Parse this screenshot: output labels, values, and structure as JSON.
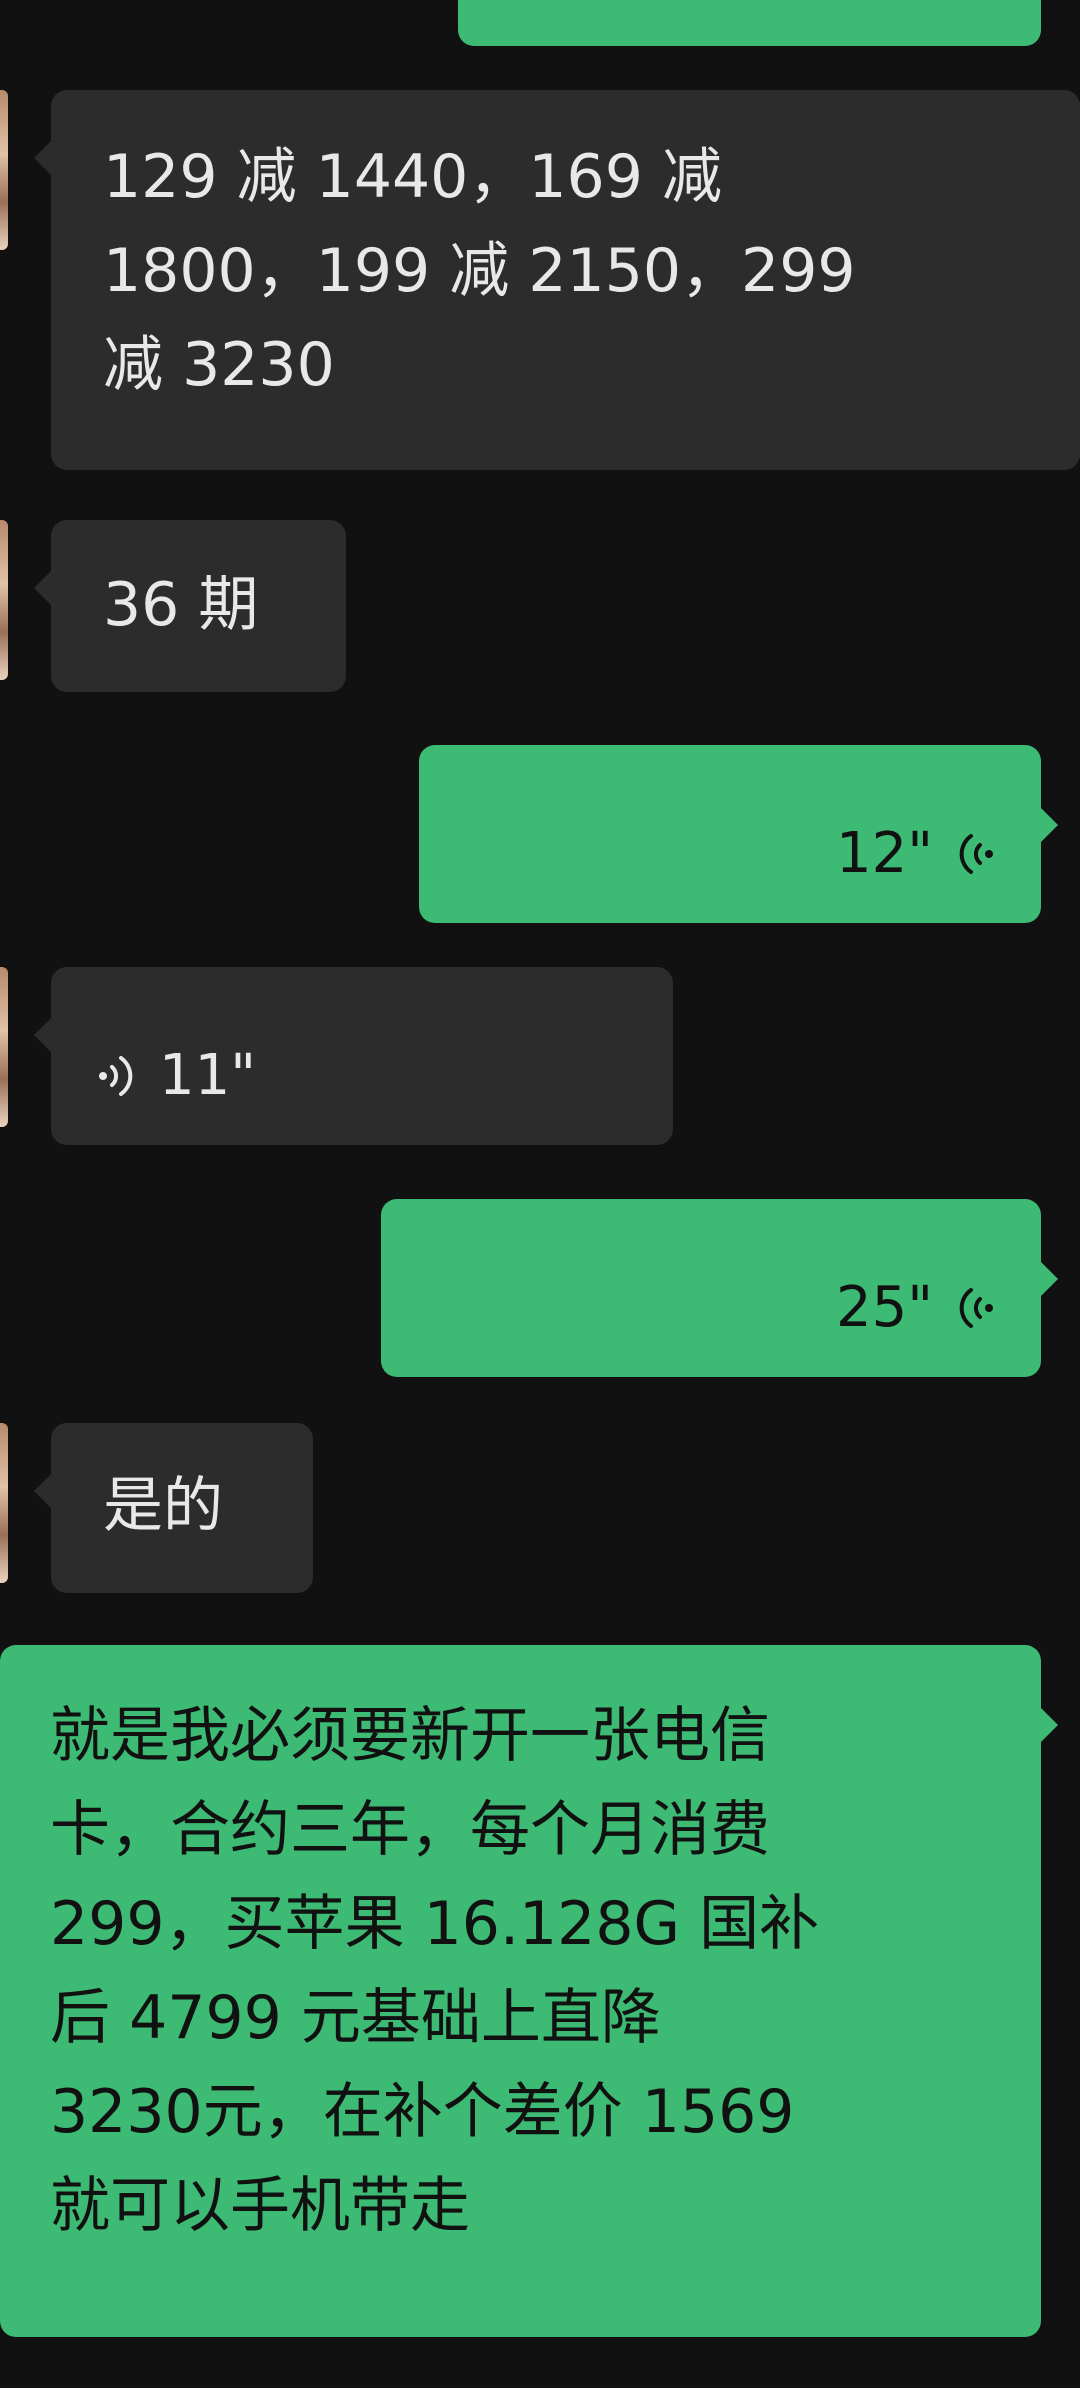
{
  "messages": [
    {
      "direction": "outgoing",
      "type": "text",
      "text": ""
    },
    {
      "direction": "incoming",
      "type": "text",
      "text": "129 减 1440，169 减\n1800，199 减 2150，299\n减 3230"
    },
    {
      "direction": "incoming",
      "type": "text",
      "text": "36 期"
    },
    {
      "direction": "outgoing",
      "type": "voice",
      "duration": "12\""
    },
    {
      "direction": "incoming",
      "type": "voice",
      "duration": "11\""
    },
    {
      "direction": "outgoing",
      "type": "voice",
      "duration": "25\""
    },
    {
      "direction": "incoming",
      "type": "text",
      "text": "是的"
    },
    {
      "direction": "outgoing",
      "type": "text",
      "text": "就是我必须要新开一张电信\n卡，合约三年，每个月消费\n299，买苹果 16.128G 国补\n后 4799 元基础上直降\n3230元，在补个差价 1569\n就可以手机带走"
    }
  ],
  "icons": {
    "voice_out": "voice-wave-icon",
    "voice_in": "voice-wave-icon"
  },
  "colors": {
    "background": "#111111",
    "incoming_bubble": "#2c2c2c",
    "outgoing_bubble": "#3dba73",
    "incoming_text": "#e8e8e8",
    "outgoing_text": "#111111"
  }
}
